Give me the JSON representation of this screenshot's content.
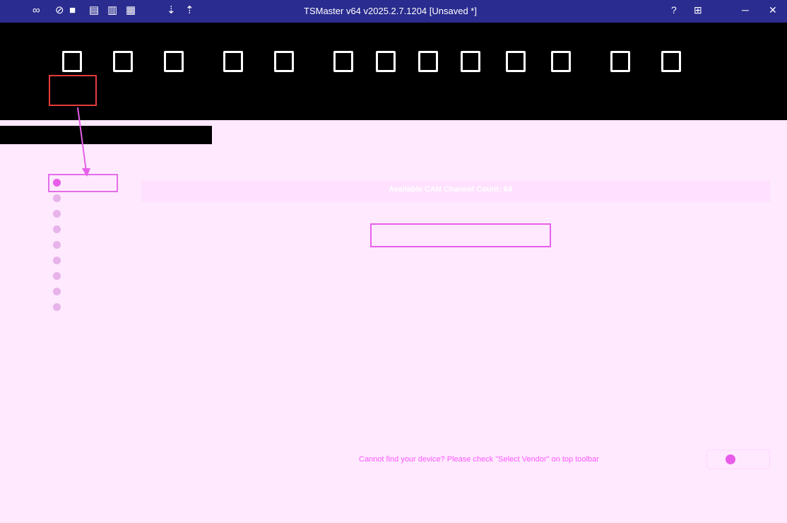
{
  "app": {
    "title": "TSMaster v64 v2025.2.7.1204 [Unsaved *]"
  },
  "quick_access": [
    {
      "icon": "link-icon",
      "glyph": "∞"
    },
    {
      "icon": "unlink-icon",
      "glyph": "⊘"
    },
    {
      "icon": "chat-icon",
      "glyph": "■"
    },
    {
      "icon": "new-file-icon",
      "glyph": "▤"
    },
    {
      "icon": "open-icon",
      "glyph": "▥"
    },
    {
      "icon": "save-icon",
      "glyph": "▦"
    },
    {
      "icon": "download-icon",
      "glyph": "⇣"
    },
    {
      "icon": "upload-icon",
      "glyph": "⇡"
    }
  ],
  "window_controls": {
    "help": "?",
    "restore": "⊞",
    "minimize": "─",
    "close": "✕"
  },
  "hint": "Cannot find your device? Please check \"Select Vendor\" on top toolbar",
  "header_bar": {
    "title": "Available CAN Channel Count: 64"
  }
}
